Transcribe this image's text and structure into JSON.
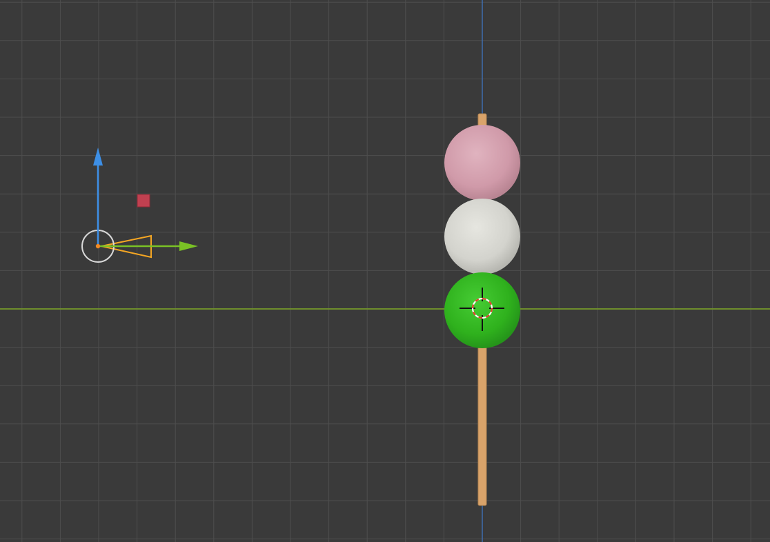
{
  "viewport": {
    "view": "3d-viewport-orthographic-side",
    "background_color": "#3a3a3a",
    "grid_line_color": "#4e4e4e",
    "grid_major_color": "#555555",
    "axis_colors": {
      "z_axis": "#3e6dae",
      "y_axis": "#6e8e2c"
    }
  },
  "scene": {
    "objects": [
      {
        "name": "dango-pink",
        "color": "#d9a5b3"
      },
      {
        "name": "dango-white",
        "color": "#dcdcd6"
      },
      {
        "name": "dango-green",
        "color": "#33bb22"
      },
      {
        "name": "skewer-stick",
        "color": "#d9a36a"
      },
      {
        "name": "camera",
        "color": "#f5a623"
      },
      {
        "name": "light",
        "color": "#c04050"
      }
    ],
    "cursor": {
      "name": "3d-cursor"
    }
  },
  "gizmo": {
    "z_color": "#3d8fe6",
    "y_color": "#7ac225",
    "origin_color": "#f08a24"
  }
}
